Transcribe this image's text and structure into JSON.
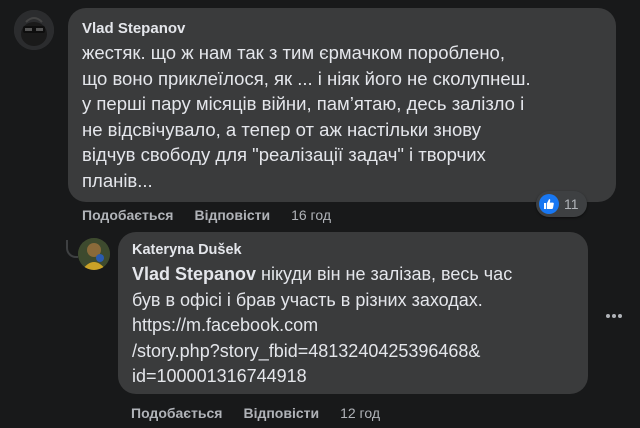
{
  "comment": {
    "author": "Vlad Stepanov",
    "text_lines": [
      "жестяк. що ж нам так з тим єрмачком пороблено,",
      "що воно приклеїлося, як ... і ніяк його не сколупнеш.",
      "у перші пару місяців війни, пам’ятаю, десь залізло і",
      "не відсвічувало, а тепер от аж настільки знову",
      "відчув свободу для \"реалізації задач\" і творчих",
      "планів..."
    ],
    "like_label": "Подобається",
    "reply_label": "Відповісти",
    "time": "16 год",
    "reaction_count": "11",
    "reaction_icon": "like-icon"
  },
  "reply": {
    "author": "Kateryna Dušek",
    "mention": "Vlad Stepanov",
    "text_line1_rest": " нікуди він не залізав, весь час",
    "text_lines": [
      "був в офісі і брав участь в різних заходах.",
      "https://m.facebook.com",
      "/story.php?story_fbid=4813240425396468&",
      "id=100001316744918"
    ],
    "like_label": "Подобається",
    "reply_label": "Відповісти",
    "time": "12 год"
  },
  "more_icon": "more-horizontal-icon",
  "colors": {
    "background": "#18191a",
    "bubble": "#3a3b3c",
    "text": "#e4e6eb",
    "secondary_text": "#b0b3b8",
    "like_blue": "#1877f2"
  }
}
